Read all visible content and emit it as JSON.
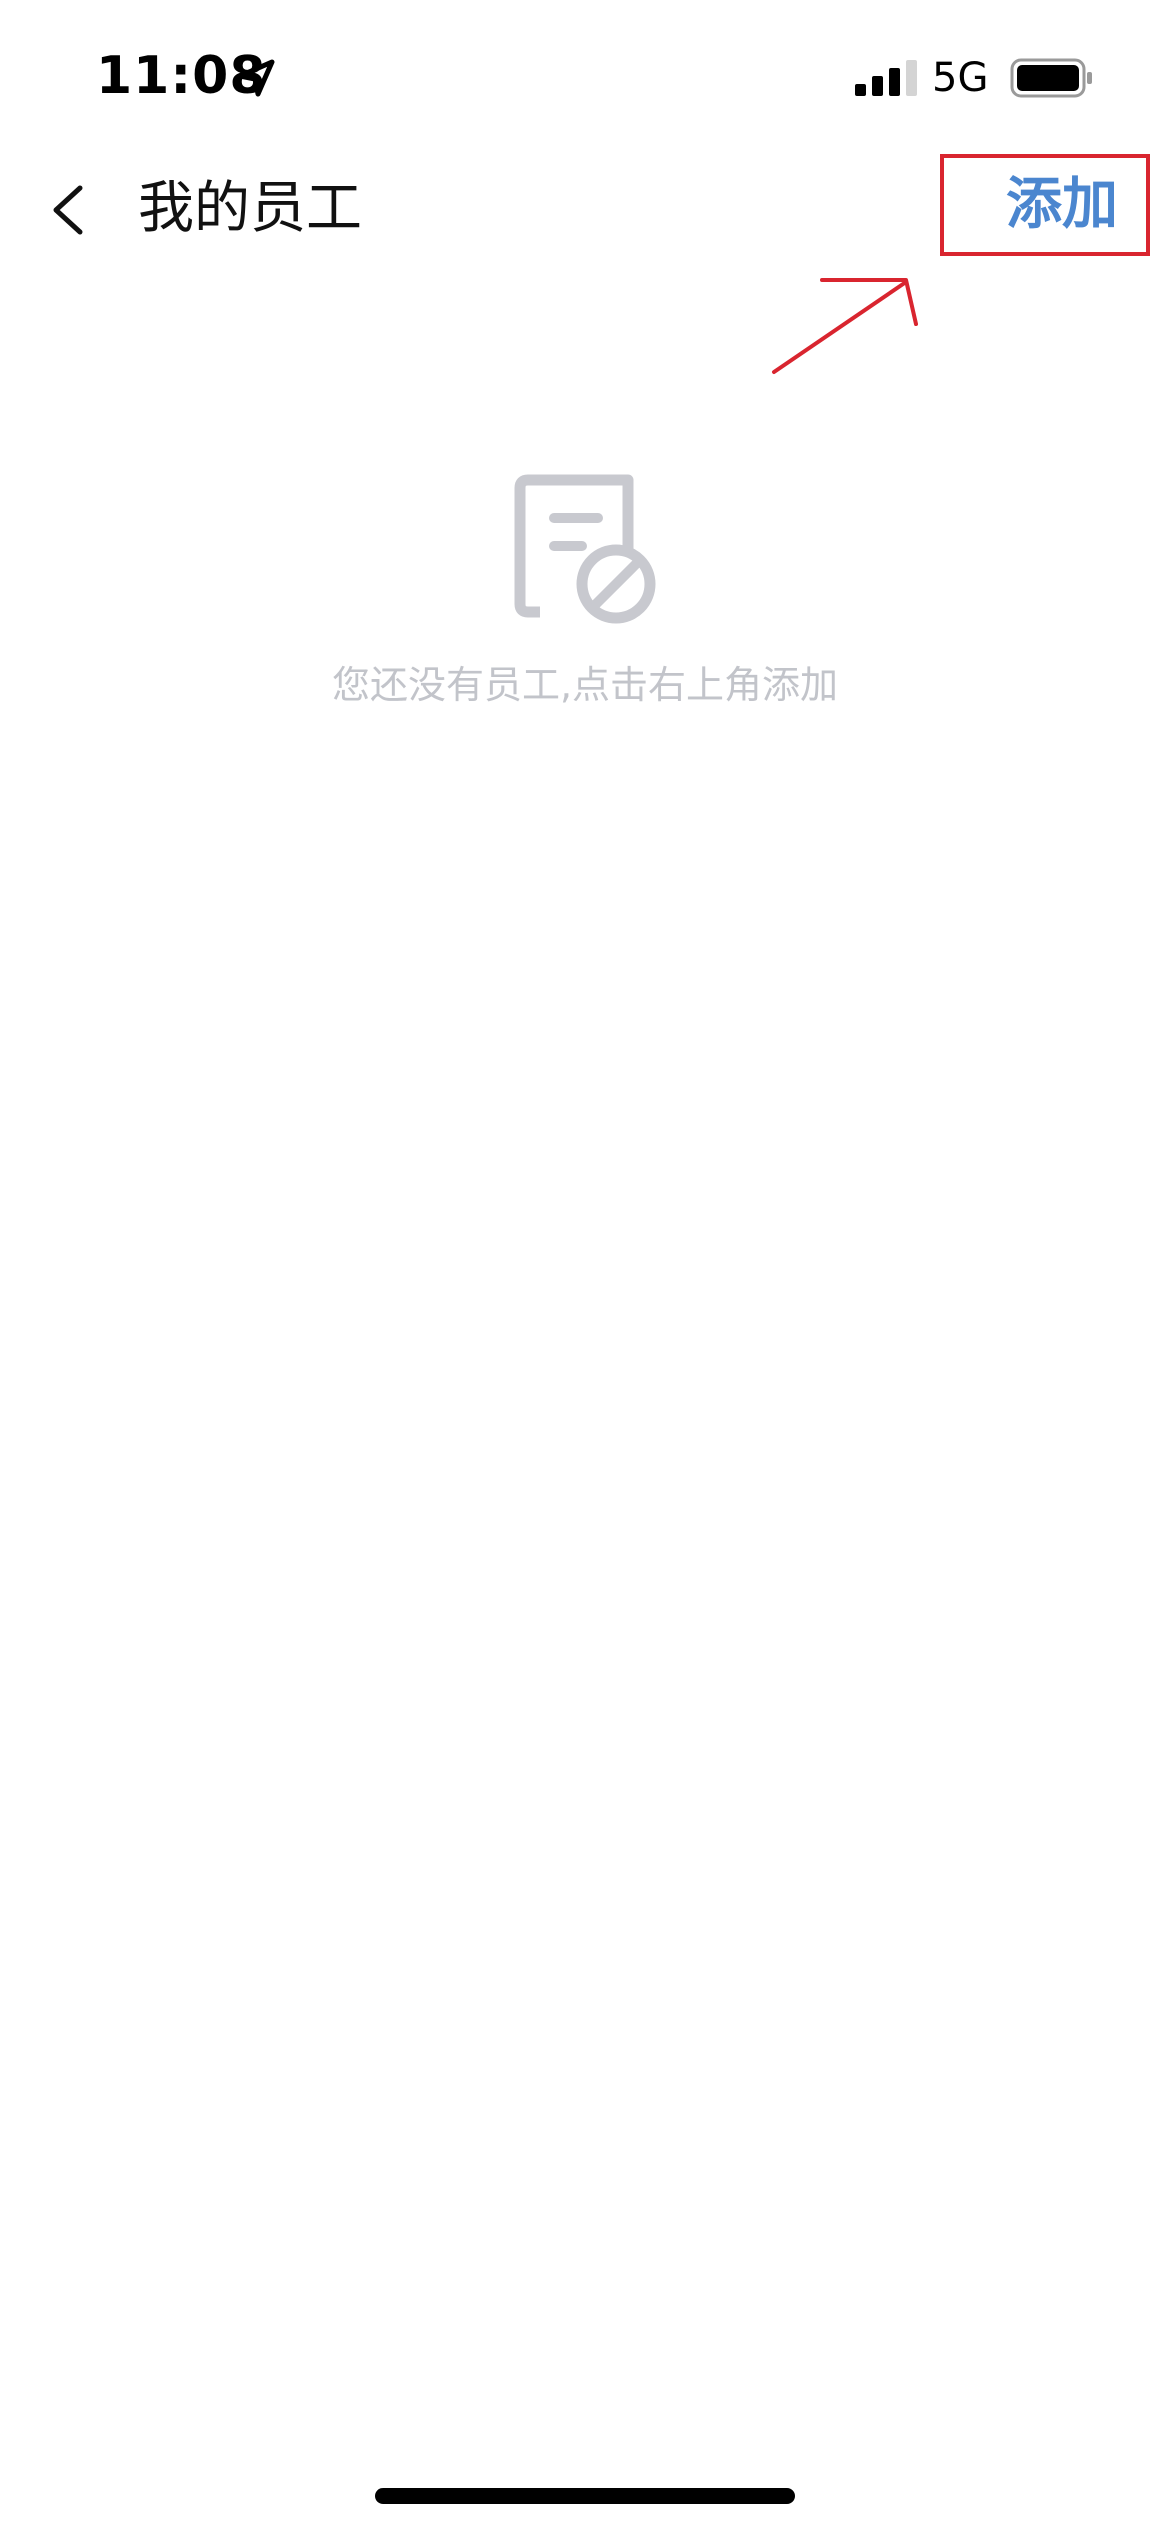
{
  "status_bar": {
    "time": "11:08",
    "network": "5G",
    "icons": [
      "location-arrow-icon",
      "signal-bars-icon",
      "battery-icon"
    ]
  },
  "nav": {
    "title": "我的员工",
    "add_label": "添加",
    "back_icon": "chevron-left-icon"
  },
  "empty_state": {
    "icon": "empty-document-icon",
    "message": "您还没有员工,点击右上角添加"
  },
  "colors": {
    "accent": "#4b86cf",
    "annotation": "#d9252f",
    "empty_text": "#c2c4ca",
    "empty_icon": "#c8c9cf"
  }
}
